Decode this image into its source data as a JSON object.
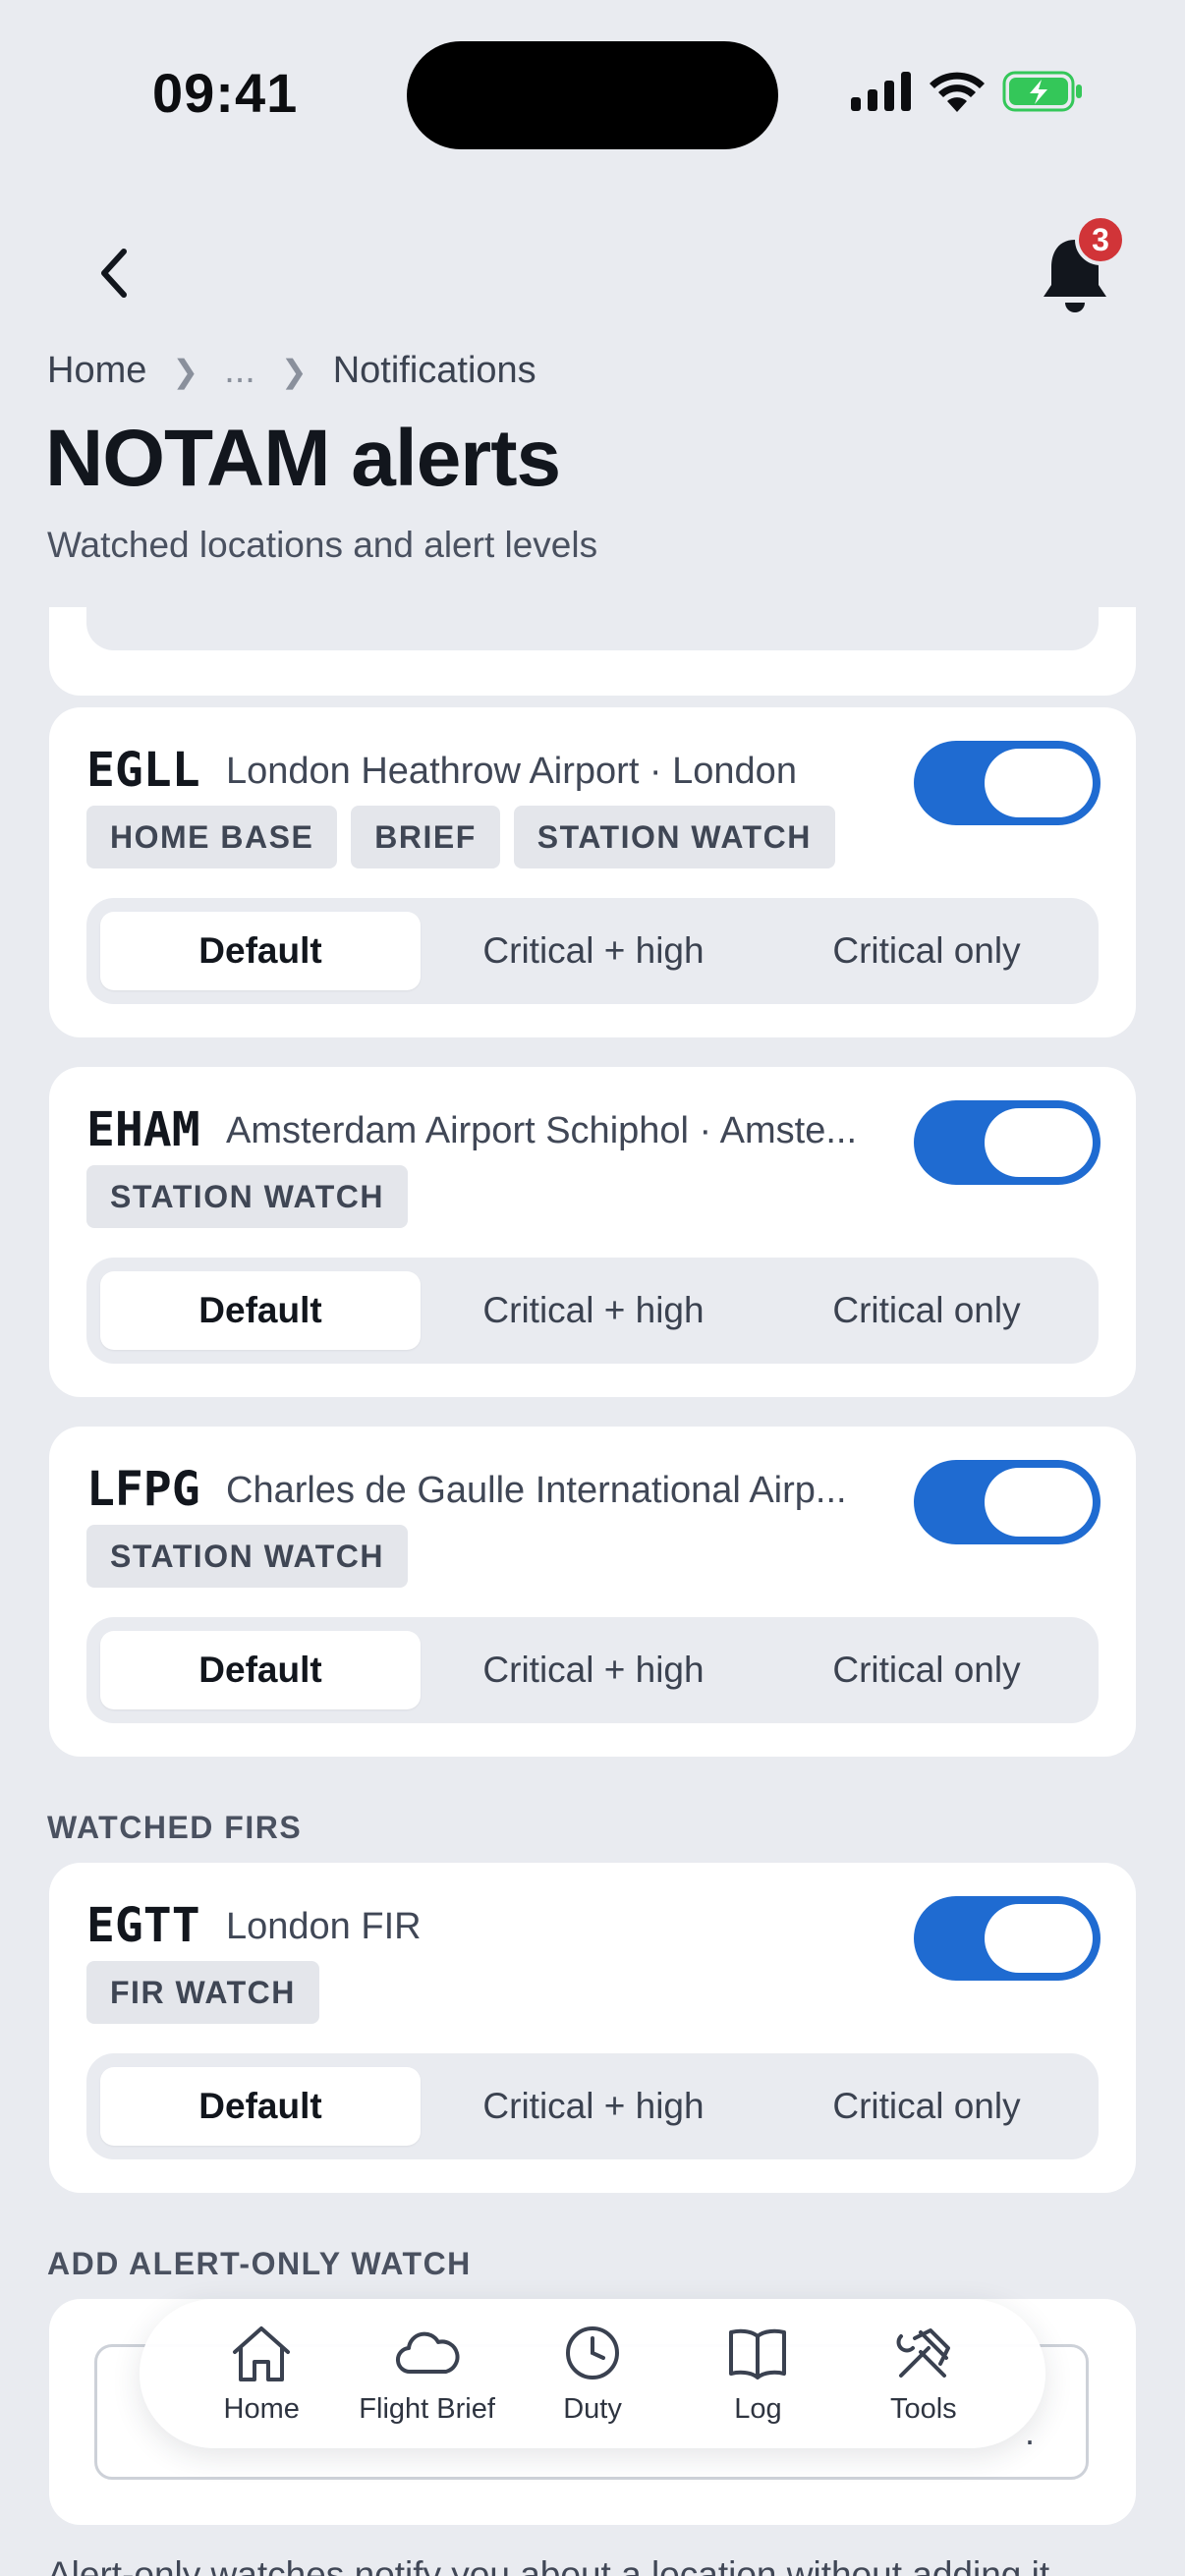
{
  "status_bar": {
    "time": "09:41"
  },
  "header": {
    "notification_count": "3",
    "breadcrumb": [
      "Home",
      "...",
      "Notifications"
    ],
    "title": "NOTAM alerts",
    "subtitle": "Watched locations and alert levels"
  },
  "alert_levels": [
    "Default",
    "Critical + high",
    "Critical only"
  ],
  "stations": [
    {
      "code": "EGLL",
      "name": "London Heathrow Airport · London",
      "tags": [
        "HOME BASE",
        "BRIEF",
        "STATION WATCH"
      ],
      "enabled": true,
      "level": "Default"
    },
    {
      "code": "EHAM",
      "name": "Amsterdam Airport Schiphol · Amste...",
      "tags": [
        "STATION WATCH"
      ],
      "enabled": true,
      "level": "Default"
    },
    {
      "code": "LFPG",
      "name": "Charles de Gaulle International Airp...",
      "tags": [
        "STATION WATCH"
      ],
      "enabled": true,
      "level": "Default"
    }
  ],
  "firs_section": {
    "label": "WATCHED FIRS",
    "items": [
      {
        "code": "EGTT",
        "name": "London FIR",
        "tags": [
          "FIR WATCH"
        ],
        "enabled": true,
        "level": "Default"
      }
    ]
  },
  "add_section": {
    "label": "ADD ALERT-ONLY WATCH",
    "input_trailing": ".",
    "footnote": "Alert-only watches notify you about a location without adding it"
  },
  "tab_bar": [
    {
      "label": "Home",
      "icon": "home-icon"
    },
    {
      "label": "Flight Brief",
      "icon": "cloud-icon"
    },
    {
      "label": "Duty",
      "icon": "clock-icon"
    },
    {
      "label": "Log",
      "icon": "book-icon"
    },
    {
      "label": "Tools",
      "icon": "tools-icon"
    }
  ],
  "colors": {
    "accent": "#1f6bd1",
    "badge": "#d13438",
    "background": "#e9ebf0",
    "battery": "#34c759"
  }
}
